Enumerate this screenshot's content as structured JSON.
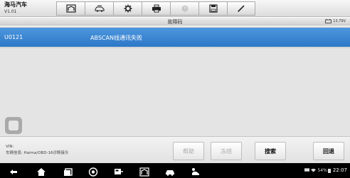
{
  "header": {
    "vehicle_name": "海马汽车",
    "version": "V1.01",
    "toolbar": [
      {
        "icon": "home-icon",
        "enabled": true
      },
      {
        "icon": "car-swap-icon",
        "enabled": true
      },
      {
        "icon": "settings-icon",
        "enabled": true
      },
      {
        "icon": "print-icon",
        "enabled": true
      },
      {
        "icon": "help-icon",
        "enabled": false
      },
      {
        "icon": "save-icon",
        "enabled": true
      },
      {
        "icon": "data-logging-icon",
        "enabled": true
      }
    ]
  },
  "page": {
    "title": "故障码",
    "battery_voltage": "13.79V"
  },
  "codes": [
    {
      "code": "U0121",
      "description": "ABSCAN线通讯失败",
      "selected": true
    }
  ],
  "footer": {
    "vin_label": "VIN:",
    "vehicle_info": "车辆信息: Haima/OBD-16诊断接头",
    "buttons": {
      "help": "帮助",
      "freeze_frame": "冻结",
      "search": "搜索",
      "back": "回退"
    }
  },
  "system_bar": {
    "battery": "54%",
    "time": "22:07"
  },
  "colors": {
    "selection": "#3a86d4",
    "background": "#dedede",
    "navbar": "#000000"
  }
}
